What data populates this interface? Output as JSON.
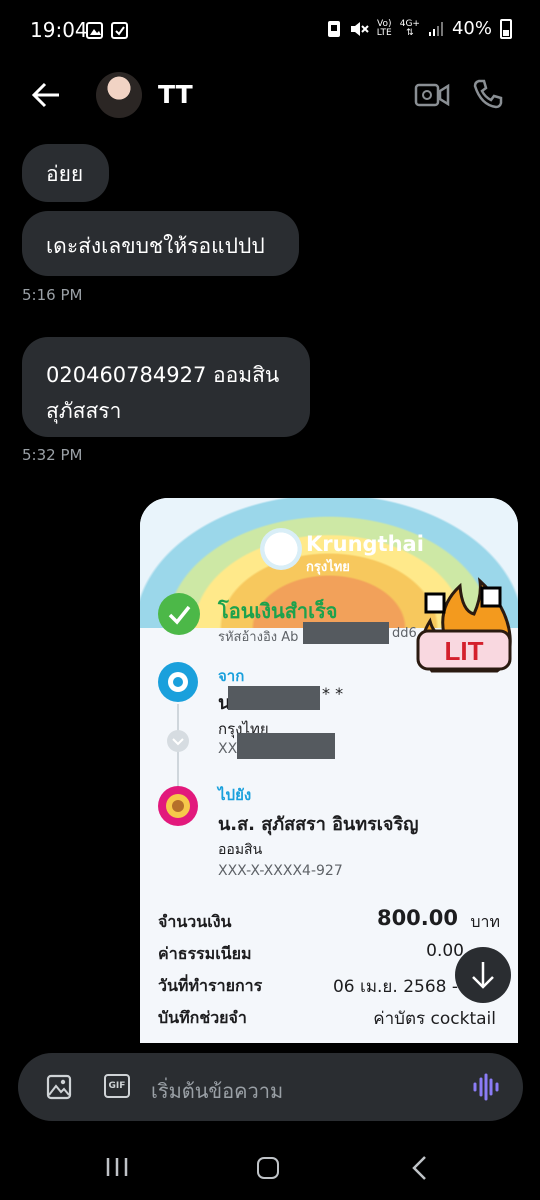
{
  "status_bar": {
    "time": "19:04",
    "network_top": "Vo)",
    "network_bottom": "LTE",
    "signal_label": "4G+",
    "battery": "40%"
  },
  "header": {
    "contact_name": "TT",
    "back_icon": "arrow-left-icon",
    "video_icon": "video-call-icon",
    "phone_icon": "phone-icon"
  },
  "messages": [
    {
      "text": "อ่ยย"
    },
    {
      "text": "เดะส่งเลขบชให้รอแปปป"
    },
    {
      "timestamp": "5:16 PM"
    },
    {
      "text_line1": "020460784927 ออมสิน",
      "text_line2": "สุภัสสรา"
    },
    {
      "timestamp": "5:32 PM"
    }
  ],
  "receipt": {
    "bank_name": "Krungthai",
    "bank_name_thai": "กรุงไทย",
    "sticker_text": "LIT",
    "status": "โอนเงินสำเร็จ",
    "ref_label": "รหัสอ้างอิง Ab",
    "ref_suffix": "dd6",
    "from_label": "จาก",
    "from_name_initial": "น",
    "from_name_suffix": "* *",
    "from_bank": "กรุงไทย",
    "from_account_prefix": "XX",
    "to_label": "ไปยัง",
    "to_name": "น.ส. สุภัสสรา อินทรเจริญ",
    "to_bank": "ออมสิน",
    "to_account": "XXX-X-XXXX4-927",
    "amount_label": "จำนวนเงิน",
    "amount_value": "800.00",
    "amount_unit": "บาท",
    "fee_label": "ค่าธรรมเนียม",
    "fee_value": "0.00",
    "date_label": "วันที่ทำรายการ",
    "date_value": "06 เม.ย. 2568 -",
    "memo_label": "บันทึกช่วยจำ",
    "memo_value": "ค่าบัตร cocktail"
  },
  "composer": {
    "placeholder": "เริ่มต้นข้อความ",
    "image_icon": "image-icon",
    "gif_label": "GIF",
    "voice_icon": "voice-wave-icon",
    "voice_color": "#8b7cf6"
  },
  "nav": {
    "recent_icon": "recent-apps-icon",
    "home_icon": "home-icon",
    "back_icon": "back-chevron-icon"
  },
  "colors": {
    "background": "#000000",
    "bubble": "#2a2d31",
    "success_green": "#4cb848",
    "krungthai_blue": "#1aa0dc"
  }
}
